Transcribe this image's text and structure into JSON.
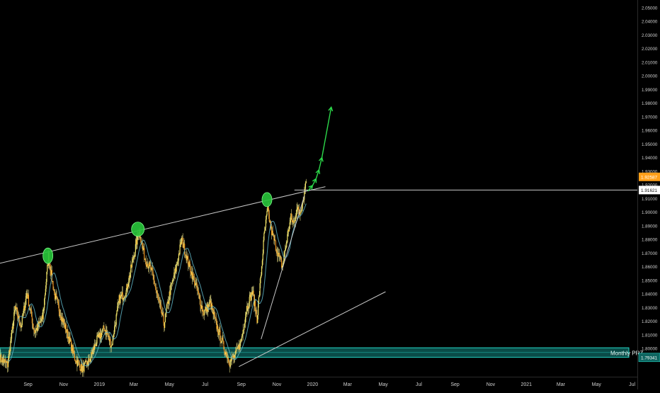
{
  "chart_data": {
    "type": "candlestick",
    "ylim": [
      1.7855,
      2.0525
    ],
    "y_ticks": [
      "1.80000",
      "1.81000",
      "1.82000",
      "1.83000",
      "1.84000",
      "1.85000",
      "1.86000",
      "1.87000",
      "1.88000",
      "1.89000",
      "1.90000",
      "1.91000",
      "1.92000",
      "1.93000",
      "1.94000",
      "1.95000",
      "1.96000",
      "1.97000",
      "1.98000",
      "1.99000",
      "2.00000",
      "2.01000",
      "2.02000",
      "2.03000",
      "2.04000",
      "2.05000"
    ],
    "x_ticks": [
      "Sep",
      "Nov",
      "2019",
      "Mar",
      "May",
      "Jul",
      "Sep",
      "Nov",
      "2020",
      "Mar",
      "May",
      "Jul",
      "Sep",
      "Nov",
      "2021",
      "Mar",
      "May",
      "Jul"
    ],
    "x_range": [
      "2018-07-15",
      "2021-07-10"
    ],
    "x_tick_dates": [
      "2018-09-01",
      "2018-11-01",
      "2019-01-01",
      "2019-03-01",
      "2019-05-01",
      "2019-07-01",
      "2019-09-01",
      "2019-11-01",
      "2020-01-01",
      "2020-03-01",
      "2020-05-01",
      "2020-07-01",
      "2020-09-01",
      "2020-11-01",
      "2021-01-01",
      "2021-03-01",
      "2021-05-01",
      "2021-07-01"
    ],
    "price_path": [
      {
        "x": "2018-07-15",
        "y": 1.793
      },
      {
        "x": "2018-07-28",
        "y": 1.788
      },
      {
        "x": "2018-08-10",
        "y": 1.83
      },
      {
        "x": "2018-08-20",
        "y": 1.816
      },
      {
        "x": "2018-08-30",
        "y": 1.841
      },
      {
        "x": "2018-09-12",
        "y": 1.812
      },
      {
        "x": "2018-09-26",
        "y": 1.822
      },
      {
        "x": "2018-10-06",
        "y": 1.868
      },
      {
        "x": "2018-10-16",
        "y": 1.84
      },
      {
        "x": "2018-10-26",
        "y": 1.826
      },
      {
        "x": "2018-11-08",
        "y": 1.81
      },
      {
        "x": "2018-11-20",
        "y": 1.793
      },
      {
        "x": "2018-12-02",
        "y": 1.785
      },
      {
        "x": "2018-12-14",
        "y": 1.79
      },
      {
        "x": "2018-12-28",
        "y": 1.806
      },
      {
        "x": "2019-01-10",
        "y": 1.815
      },
      {
        "x": "2019-01-22",
        "y": 1.802
      },
      {
        "x": "2019-02-04",
        "y": 1.836
      },
      {
        "x": "2019-02-16",
        "y": 1.842
      },
      {
        "x": "2019-02-28",
        "y": 1.866
      },
      {
        "x": "2019-03-10",
        "y": 1.887
      },
      {
        "x": "2019-03-20",
        "y": 1.866
      },
      {
        "x": "2019-04-01",
        "y": 1.856
      },
      {
        "x": "2019-04-12",
        "y": 1.835
      },
      {
        "x": "2019-04-22",
        "y": 1.818
      },
      {
        "x": "2019-05-02",
        "y": 1.842
      },
      {
        "x": "2019-05-12",
        "y": 1.858
      },
      {
        "x": "2019-05-22",
        "y": 1.88
      },
      {
        "x": "2019-06-03",
        "y": 1.862
      },
      {
        "x": "2019-06-16",
        "y": 1.845
      },
      {
        "x": "2019-06-28",
        "y": 1.826
      },
      {
        "x": "2019-07-10",
        "y": 1.833
      },
      {
        "x": "2019-07-22",
        "y": 1.815
      },
      {
        "x": "2019-08-02",
        "y": 1.801
      },
      {
        "x": "2019-08-12",
        "y": 1.79
      },
      {
        "x": "2019-08-22",
        "y": 1.795
      },
      {
        "x": "2019-09-01",
        "y": 1.806
      },
      {
        "x": "2019-09-10",
        "y": 1.829
      },
      {
        "x": "2019-09-20",
        "y": 1.842
      },
      {
        "x": "2019-09-28",
        "y": 1.822
      },
      {
        "x": "2019-10-04",
        "y": 1.85
      },
      {
        "x": "2019-10-10",
        "y": 1.882
      },
      {
        "x": "2019-10-16",
        "y": 1.902
      },
      {
        "x": "2019-10-22",
        "y": 1.887
      },
      {
        "x": "2019-10-28",
        "y": 1.878
      },
      {
        "x": "2019-11-04",
        "y": 1.868
      },
      {
        "x": "2019-11-10",
        "y": 1.86
      },
      {
        "x": "2019-11-15",
        "y": 1.872
      },
      {
        "x": "2019-11-20",
        "y": 1.885
      },
      {
        "x": "2019-11-25",
        "y": 1.896
      },
      {
        "x": "2019-11-30",
        "y": 1.891
      },
      {
        "x": "2019-12-05",
        "y": 1.903
      },
      {
        "x": "2019-12-10",
        "y": 1.899
      },
      {
        "x": "2019-12-15",
        "y": 1.908
      },
      {
        "x": "2019-12-18",
        "y": 1.914
      },
      {
        "x": "2019-12-21",
        "y": 1.9255
      }
    ],
    "current_price_label": "1.92587",
    "horizontal_level_label": "1.91621",
    "horizontal_level": 1.91621,
    "zone_label": "Monthly PRZ",
    "zone_price_label": "1.79341",
    "zone": [
      1.7935,
      1.8005
    ],
    "trendlines": [
      {
        "from": {
          "x": "2018-07-15",
          "y": 1.8625
        },
        "to": {
          "x": "2020-01-23",
          "y": 1.9187
        }
      },
      {
        "from": {
          "x": "2019-10-05",
          "y": 1.8069
        },
        "to": {
          "x": "2019-12-18",
          "y": 1.912
        }
      },
      {
        "from": {
          "x": "2019-08-28",
          "y": 1.7867
        },
        "to": {
          "x": "2020-05-05",
          "y": 1.8416
        }
      }
    ],
    "pivot_markers": [
      {
        "x": "2018-10-05",
        "y": 1.868
      },
      {
        "x": "2019-03-08",
        "y": 1.8875
      },
      {
        "x": "2019-10-15",
        "y": 1.9092
      }
    ],
    "projection_path": [
      {
        "x": "2019-12-24",
        "y": 1.9155
      },
      {
        "x": "2020-01-01",
        "y": 1.9195
      },
      {
        "x": "2020-01-07",
        "y": 1.9245
      },
      {
        "x": "2020-01-12",
        "y": 1.931
      },
      {
        "x": "2020-01-17",
        "y": 1.94
      },
      {
        "x": "2020-02-02",
        "y": 1.977
      }
    ],
    "colors": {
      "background": "#000000",
      "up_candle": "#f5e663",
      "down_candle": "#e88c1a",
      "wick": "#d4cc7a",
      "moving_average": "#5fb4c4",
      "trendline": "#c8c8c8",
      "pivot_marker": "#27c23a",
      "projection": "#2cd84a",
      "zone_fill": "#0e6560",
      "zone_border": "#25d4c4",
      "axis_text": "#cfcfcf",
      "price_badge": "#ff9f1a"
    }
  }
}
